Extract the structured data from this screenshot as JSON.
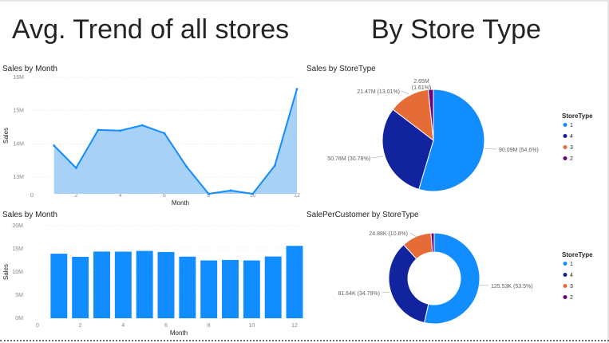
{
  "headers": {
    "left": "Avg. Trend of all stores",
    "right": "By Store Type"
  },
  "colors": {
    "blue": "#118DFF",
    "navy": "#12239E",
    "orange": "#E66C37",
    "purple": "#6B007B",
    "area_fill": "#a7d1f7",
    "area_line": "#118DFF"
  },
  "chart_data": [
    {
      "type": "area",
      "title": "Sales by Month",
      "xlabel": "Month",
      "ylabel": "Sales",
      "x": [
        1,
        2,
        3,
        4,
        5,
        6,
        7,
        8,
        9,
        10,
        11,
        12
      ],
      "values": [
        13.95,
        13.28,
        14.42,
        14.4,
        14.56,
        14.32,
        13.32,
        12.5,
        12.6,
        12.5,
        13.35,
        15.65
      ],
      "xticks": [
        "0",
        "2",
        "4",
        "6",
        "8",
        "10",
        "12"
      ],
      "yticks": [
        "13M",
        "14M",
        "15M",
        "16M"
      ],
      "yunit": "M",
      "ylim": [
        12.5,
        16
      ],
      "xlim": [
        0,
        12
      ]
    },
    {
      "type": "bar",
      "title": "Sales by Month",
      "xlabel": "Month",
      "ylabel": "Sales",
      "x": [
        1,
        2,
        3,
        4,
        5,
        6,
        7,
        8,
        9,
        10,
        11,
        12
      ],
      "values": [
        13.95,
        13.28,
        14.42,
        14.4,
        14.56,
        14.32,
        13.32,
        12.5,
        12.6,
        12.5,
        13.35,
        15.65
      ],
      "xticks": [
        "0",
        "2",
        "4",
        "6",
        "8",
        "10",
        "12"
      ],
      "yticks": [
        "0M",
        "5M",
        "10M",
        "15M",
        "20M"
      ],
      "yunit": "M",
      "ylim": [
        0,
        20
      ],
      "xlim": [
        0,
        12
      ]
    },
    {
      "type": "pie",
      "title": "Sales by StoreType",
      "legend_title": "StoreType",
      "slices": [
        {
          "name": "1",
          "value": 54.6,
          "label": "90.09M (54.6%)"
        },
        {
          "name": "4",
          "value": 30.78,
          "label": "50.78M (30.78%)"
        },
        {
          "name": "3",
          "value": 13.01,
          "label": "21.47M (13.01%)"
        },
        {
          "name": "2",
          "value": 1.61,
          "label": "2.65M (1.61%)"
        }
      ]
    },
    {
      "type": "pie",
      "title": "SalePerCustomer by StoreType",
      "legend_title": "StoreType",
      "slices": [
        {
          "name": "1",
          "value": 53.5,
          "label": "125.53K (53.5%)"
        },
        {
          "name": "4",
          "value": 34.79,
          "label": "81.64K (34.79%)"
        },
        {
          "name": "3",
          "value": 10.6,
          "label": "24.88K (10.6%)"
        },
        {
          "name": "2",
          "value": 1.11,
          "label": ""
        }
      ]
    }
  ]
}
